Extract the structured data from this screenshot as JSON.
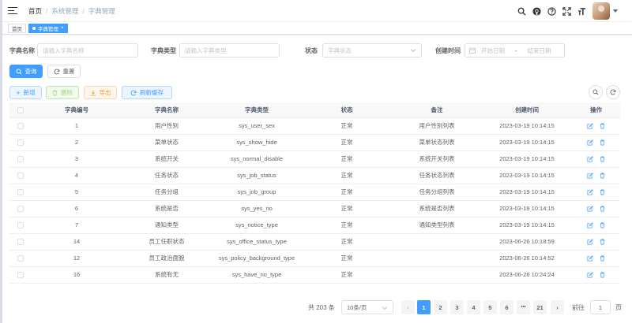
{
  "breadcrumb": [
    "首页",
    "系统管理",
    "字典管理"
  ],
  "tags": [
    {
      "label": "首页",
      "active": false
    },
    {
      "label": "字典管理",
      "active": true,
      "close": "×"
    }
  ],
  "filters": {
    "dict_name": {
      "label": "字典名称",
      "placeholder": "请输入字典名称"
    },
    "dict_type": {
      "label": "字典类型",
      "placeholder": "请输入字典类型"
    },
    "status": {
      "label": "状态",
      "placeholder": "字典状态"
    },
    "create_time": {
      "label": "创建时间",
      "start_placeholder": "开始日期",
      "separator": "-",
      "end_placeholder": "结束日期"
    }
  },
  "search_buttons": {
    "search": "查询",
    "reset": "重置"
  },
  "toolbar": {
    "add": "新增",
    "delete": "删除",
    "export": "导出",
    "refresh_cache": "刷新缓存"
  },
  "table": {
    "columns": [
      "字典编号",
      "字典名称",
      "字典类型",
      "状态",
      "备注",
      "创建时间",
      "操作"
    ],
    "rows": [
      {
        "id": "1",
        "name": "用户性别",
        "type": "sys_user_sex",
        "status": "正常",
        "remark": "用户性别列表",
        "time": "2023-03-19 10:14:15"
      },
      {
        "id": "2",
        "name": "菜单状态",
        "type": "sys_show_hide",
        "status": "正常",
        "remark": "菜单状态列表",
        "time": "2023-03-19 10:14:15"
      },
      {
        "id": "3",
        "name": "系统开关",
        "type": "sys_normal_disable",
        "status": "正常",
        "remark": "系统开关列表",
        "time": "2023-03-19 10:14:15"
      },
      {
        "id": "4",
        "name": "任务状态",
        "type": "sys_job_status",
        "status": "正常",
        "remark": "任务状态列表",
        "time": "2023-03-19 10:14:15"
      },
      {
        "id": "5",
        "name": "任务分组",
        "type": "sys_job_group",
        "status": "正常",
        "remark": "任务分组列表",
        "time": "2023-03-19 10:14:15"
      },
      {
        "id": "6",
        "name": "系统是否",
        "type": "sys_yes_no",
        "status": "正常",
        "remark": "系统是否列表",
        "time": "2023-03-19 10:14:15"
      },
      {
        "id": "7",
        "name": "通知类型",
        "type": "sys_notice_type",
        "status": "正常",
        "remark": "通知类型列表",
        "time": "2023-03-19 10:14:15"
      },
      {
        "id": "14",
        "name": "员工任职状态",
        "type": "sys_office_status_type",
        "status": "正常",
        "remark": "",
        "time": "2023-06-26 10:18:59"
      },
      {
        "id": "12",
        "name": "员工政治面貌",
        "type": "sys_policy_background_type",
        "status": "正常",
        "remark": "",
        "time": "2023-06-26 10:14:52"
      },
      {
        "id": "16",
        "name": "系统有无",
        "type": "sys_have_no_type",
        "status": "正常",
        "remark": "",
        "time": "2023-06-26 10:24:24"
      }
    ]
  },
  "pagination": {
    "total_text": "共 203 条",
    "page_size": "10条/页",
    "prev": "‹",
    "next": "›",
    "pages": [
      "1",
      "2",
      "3",
      "4",
      "5",
      "6",
      "•••",
      "21"
    ],
    "current": "1",
    "goto_label": "前往",
    "goto_value": "1",
    "page_unit": "页"
  },
  "colors": {
    "primary": "#409eff",
    "danger": "#f56c6c",
    "warning": "#e6a23c",
    "success": "#67c23a"
  },
  "icons": [
    "hamburger-icon",
    "search-icon",
    "github-icon",
    "question-icon",
    "fullscreen-icon",
    "font-size-icon",
    "calendar-icon",
    "refresh-icon",
    "plus-icon",
    "delete-icon",
    "download-icon",
    "edit-icon",
    "chevron-down-icon"
  ]
}
